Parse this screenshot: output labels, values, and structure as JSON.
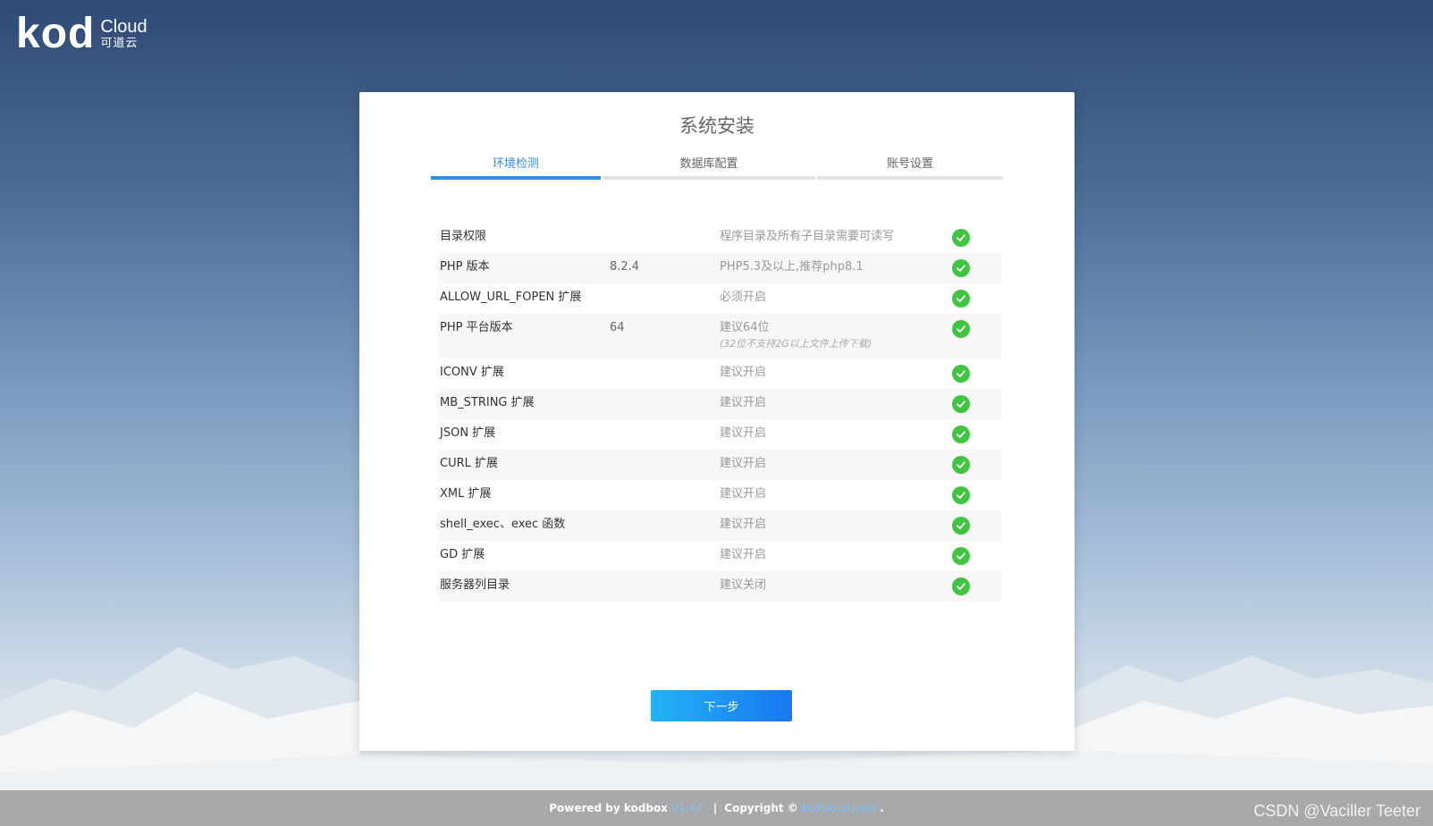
{
  "logo": {
    "mark": "kod",
    "cloud": "Cloud",
    "cn": "可道云"
  },
  "card": {
    "title": "系统安装",
    "steps": [
      {
        "label": "环境检测",
        "active": true
      },
      {
        "label": "数据库配置",
        "active": false
      },
      {
        "label": "账号设置",
        "active": false
      }
    ],
    "checks": [
      {
        "name": "目录权限",
        "value": "",
        "desc": "程序目录及所有子目录需要可读写",
        "note": ""
      },
      {
        "name": "PHP 版本",
        "value": "8.2.4",
        "desc": "PHP5.3及以上,推荐php8.1",
        "note": ""
      },
      {
        "name": "ALLOW_URL_FOPEN 扩展",
        "value": "",
        "desc": "必须开启",
        "note": ""
      },
      {
        "name": "PHP 平台版本",
        "value": "64",
        "desc": "建议64位",
        "note": "(32位不支持2G以上文件上传下载)"
      },
      {
        "name": "ICONV 扩展",
        "value": "",
        "desc": "建议开启",
        "note": ""
      },
      {
        "name": "MB_STRING 扩展",
        "value": "",
        "desc": "建议开启",
        "note": ""
      },
      {
        "name": "JSON 扩展",
        "value": "",
        "desc": "建议开启",
        "note": ""
      },
      {
        "name": "CURL 扩展",
        "value": "",
        "desc": "建议开启",
        "note": ""
      },
      {
        "name": "XML 扩展",
        "value": "",
        "desc": "建议开启",
        "note": ""
      },
      {
        "name": "shell_exec、exec 函数",
        "value": "",
        "desc": "建议开启",
        "note": ""
      },
      {
        "name": "GD 扩展",
        "value": "",
        "desc": "建议开启",
        "note": ""
      },
      {
        "name": "服务器列目录",
        "value": "",
        "desc": "建议关闭",
        "note": ""
      }
    ],
    "next_label": "下一步"
  },
  "footer": {
    "powered": "Powered by kodbox",
    "version": "V1.44",
    "separator": "|",
    "copyright": "Copyright ©",
    "link": "kodcloud.com",
    "dot": "."
  },
  "watermark": "CSDN @Vaciller Teeter",
  "colors": {
    "accent": "#2e8ded",
    "ok": "#3fc53f",
    "button_start": "#22b3f5",
    "button_end": "#1877f2"
  }
}
